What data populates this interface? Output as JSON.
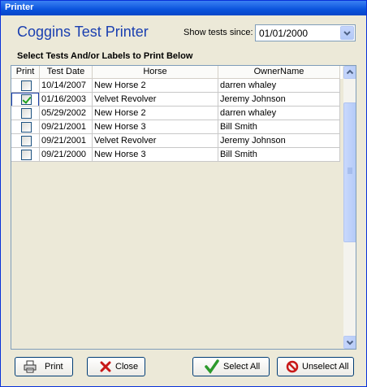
{
  "window": {
    "title": "Printer"
  },
  "header": {
    "title": "Coggins Test Printer",
    "since_label": "Show tests since:",
    "since_value": "01/01/2000"
  },
  "section_label": "Select Tests And/or Labels to Print Below",
  "grid": {
    "columns": [
      "Print",
      "Test Date",
      "Horse",
      "OwnerName"
    ],
    "rows": [
      {
        "checked": false,
        "date": "10/14/2007",
        "horse": "New Horse 2",
        "owner": "darren whaley"
      },
      {
        "checked": true,
        "date": "01/16/2003",
        "horse": "Velvet Revolver",
        "owner": "Jeremy Johnson"
      },
      {
        "checked": false,
        "date": "05/29/2002",
        "horse": "New Horse 2",
        "owner": "darren whaley"
      },
      {
        "checked": false,
        "date": "09/21/2001",
        "horse": "New Horse 3",
        "owner": "Bill Smith"
      },
      {
        "checked": false,
        "date": "09/21/2001",
        "horse": "Velvet Revolver",
        "owner": "Jeremy Johnson"
      },
      {
        "checked": false,
        "date": "09/21/2000",
        "horse": "New Horse 3",
        "owner": "Bill Smith"
      }
    ]
  },
  "buttons": {
    "print": "Print",
    "close": "Close",
    "select_all": "Select All",
    "unselect_all": "Unselect All"
  },
  "icons": {
    "print": "printer-icon",
    "close": "red-x-icon",
    "select_all": "green-check-icon",
    "unselect_all": "no-symbol-icon"
  }
}
